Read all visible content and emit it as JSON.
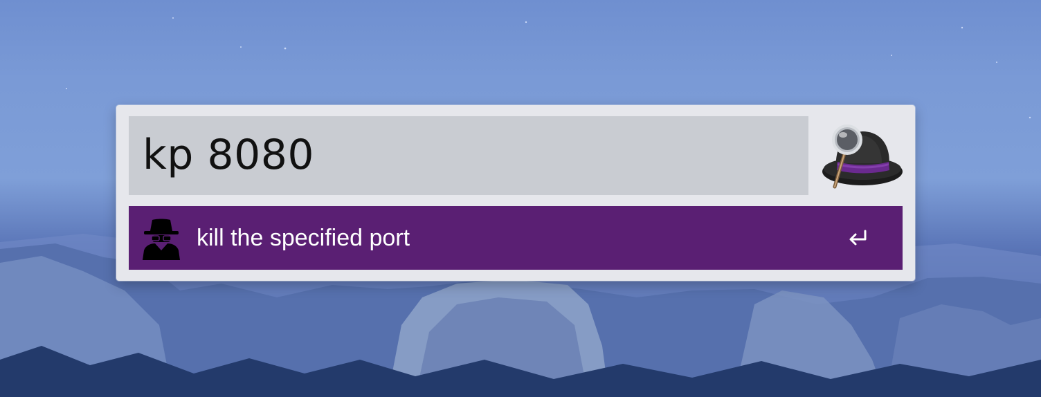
{
  "window": {
    "title": ""
  },
  "search": {
    "query": "kp 8080"
  },
  "app_icon": {
    "name": "alfred-hat-icon"
  },
  "results": [
    {
      "label": "kill the specified port",
      "icon": "spy-icon",
      "action_icon": "return-key-icon",
      "selected": true
    }
  ],
  "colors": {
    "panel_bg": "#e6e7ec",
    "query_bg": "#c9ccd2",
    "selected_row": "#5a1f73",
    "hat_band": "#6a2a8f"
  }
}
